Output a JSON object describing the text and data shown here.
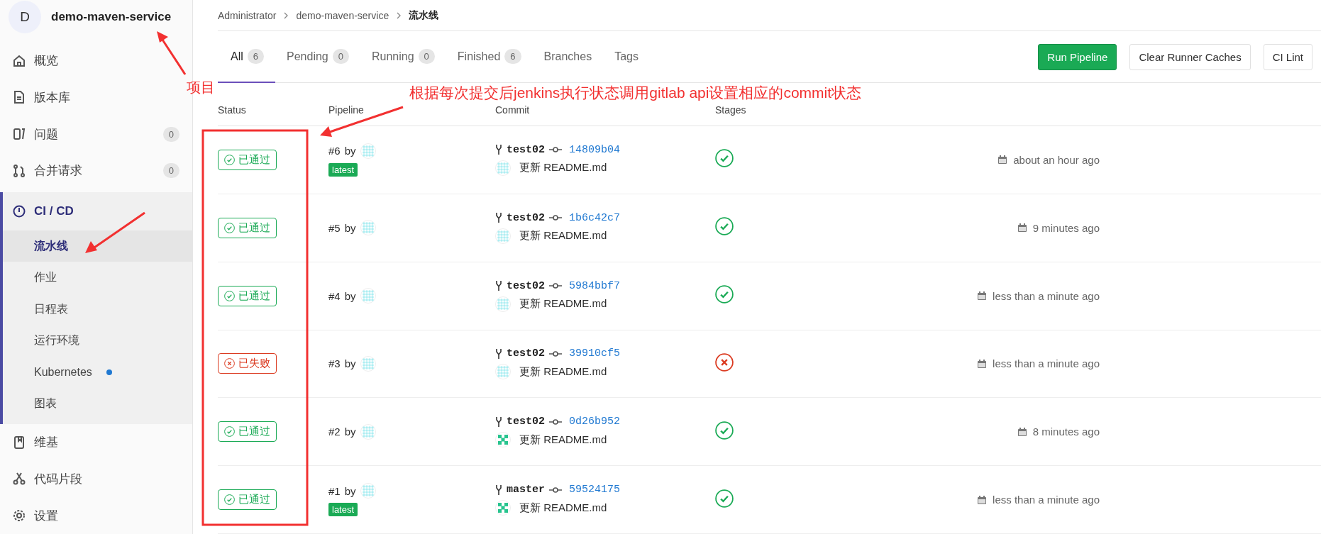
{
  "project": {
    "avatar_letter": "D",
    "name": "demo-maven-service"
  },
  "nav": [
    {
      "label": "概览",
      "selected": false
    },
    {
      "label": "版本库",
      "selected": false
    },
    {
      "label": "问题",
      "count": "0",
      "selected": false
    },
    {
      "label": "合并请求",
      "count": "0",
      "selected": false
    },
    {
      "label": "CI / CD",
      "selected": true,
      "expanded": true,
      "children": [
        {
          "label": "流水线",
          "selected": true,
          "dot": false
        },
        {
          "label": "作业",
          "selected": false,
          "dot": false
        },
        {
          "label": "日程表",
          "selected": false,
          "dot": false
        },
        {
          "label": "运行环境",
          "selected": false,
          "dot": false
        },
        {
          "label": "Kubernetes",
          "selected": false,
          "dot": true
        },
        {
          "label": "图表",
          "selected": false,
          "dot": false
        }
      ]
    },
    {
      "label": "维基",
      "selected": false
    },
    {
      "label": "代码片段",
      "selected": false
    },
    {
      "label": "设置",
      "selected": false
    }
  ],
  "breadcrumb": [
    "Administrator",
    "demo-maven-service",
    "流水线"
  ],
  "tabs": [
    {
      "label": "All",
      "count": "6",
      "selected": true
    },
    {
      "label": "Pending",
      "count": "0",
      "selected": false
    },
    {
      "label": "Running",
      "count": "0",
      "selected": false
    },
    {
      "label": "Finished",
      "count": "6",
      "selected": false
    },
    {
      "label": "Branches",
      "selected": false
    },
    {
      "label": "Tags",
      "selected": false
    }
  ],
  "buttons": [
    {
      "label": "Run Pipeline",
      "kind": "primary"
    },
    {
      "label": "Clear Runner Caches",
      "kind": "default"
    },
    {
      "label": "CI Lint",
      "kind": "default"
    }
  ],
  "table": {
    "columns": [
      "Status",
      "Pipeline",
      "Commit",
      "Stages"
    ],
    "rows": [
      {
        "status": {
          "label": "已通过",
          "kind": "passed"
        },
        "number": "#6",
        "by": "by",
        "tag": "latest",
        "branch": "test02",
        "sha": "14809b04",
        "message": "更新 README.md",
        "stage_passed": true,
        "time": "about an hour ago"
      },
      {
        "status": {
          "label": "已通过",
          "kind": "passed"
        },
        "number": "#5",
        "by": "by",
        "branch": "test02",
        "sha": "1b6c42c7",
        "message": "更新 README.md",
        "stage_passed": true,
        "time": "9 minutes ago"
      },
      {
        "status": {
          "label": "已通过",
          "kind": "passed"
        },
        "number": "#4",
        "by": "by",
        "branch": "test02",
        "sha": "5984bbf7",
        "message": "更新 README.md",
        "stage_passed": true,
        "time": "less than a minute ago"
      },
      {
        "status": {
          "label": "已失败",
          "kind": "failed"
        },
        "number": "#3",
        "by": "by",
        "branch": "test02",
        "sha": "39910cf5",
        "message": "更新 README.md",
        "stage_passed": false,
        "time": "less than a minute ago"
      },
      {
        "status": {
          "label": "已通过",
          "kind": "passed"
        },
        "number": "#2",
        "by": "by",
        "branch": "test02",
        "sha": "0d26b952",
        "message": "更新 README.md",
        "stage_passed": true,
        "time": "8 minutes ago"
      },
      {
        "status": {
          "label": "已通过",
          "kind": "passed"
        },
        "number": "#1",
        "by": "by",
        "tag": "latest",
        "branch": "master",
        "sha": "59524175",
        "message": "更新 README.md",
        "stage_passed": true,
        "time": "less than a minute ago"
      }
    ]
  },
  "annotations": [
    {
      "text": "项目"
    },
    {
      "text": "根据每次提交后jenkins执行状态调用gitlab api设置相应的commit状态"
    }
  ]
}
